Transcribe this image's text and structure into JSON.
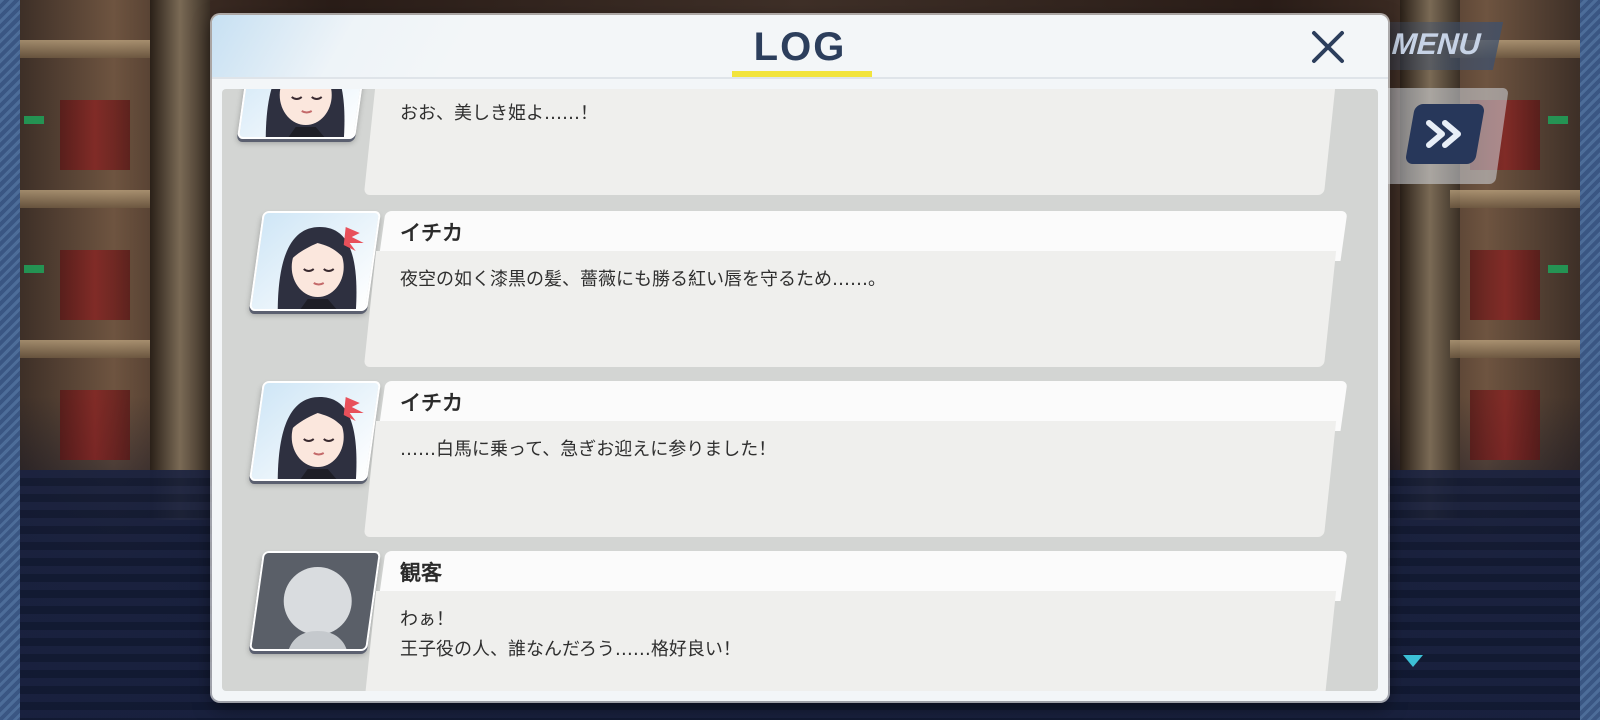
{
  "hud": {
    "menu_label": "MENU",
    "skip_icon": "fast-forward-icon"
  },
  "log": {
    "title": "LOG",
    "close_icon": "close-icon",
    "accent_color": "#f2e43c",
    "entries": [
      {
        "speaker": "",
        "portrait": "character",
        "text": "おお、美しき姫よ……！"
      },
      {
        "speaker": "イチカ",
        "portrait": "character",
        "text": "夜空の如く漆黒の髪、薔薇にも勝る紅い唇を守るため……。"
      },
      {
        "speaker": "イチカ",
        "portrait": "character",
        "text": "……白馬に乗って、急ぎお迎えに参りました！"
      },
      {
        "speaker": "観客",
        "portrait": "silhouette",
        "text_line1": "わぁ！",
        "text_line2": "王子役の人、誰なんだろう……格好良い！"
      }
    ]
  }
}
